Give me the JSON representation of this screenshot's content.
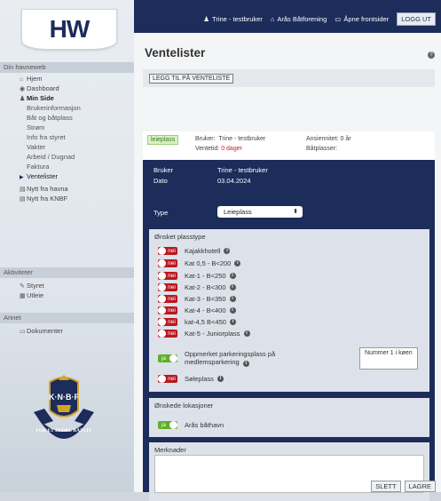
{
  "logo": "HW",
  "sidebar": {
    "section_1": "Din havneweb",
    "items": [
      {
        "label": "Hjem",
        "icon": "home-icon"
      },
      {
        "label": "Dashboard",
        "icon": "dashboard-icon"
      },
      {
        "label": "Min Side",
        "icon": "user-icon"
      }
    ],
    "sub_items": [
      "Brukerinformasjon",
      "Båt og båtplass",
      "Strøm",
      "Info fra styret",
      "Vakter",
      "Arbeid / Dugnad",
      "Faktura",
      "Ventelister"
    ],
    "news": [
      "Nytt fra havna",
      "Nytt fra KNBF"
    ],
    "section_2": "Aktiviteter",
    "activities": [
      "Styret",
      "Utleie"
    ],
    "section_3": "Annet",
    "other": [
      "Dokumenter"
    ],
    "knbf_text": "K·N·B·F",
    "knbf_ring": "FOR ET BEDRE BÅTLIV"
  },
  "topbar": {
    "user": "Trine - testbruker",
    "club": "Arås Båtforening",
    "front": "Åpne frontsider",
    "logout": "LOGG UT"
  },
  "main": {
    "title": "Ventelister",
    "add_button": "LEGG TIL PÅ VENTELISTE"
  },
  "info": {
    "badge": "leieplass",
    "bruker_label": "Bruker:",
    "bruker_value": "Trine - testbruker",
    "ventetid_label": "Ventetid:",
    "ventetid_value": "0 dager",
    "ansiennitet": "Ansiennitet: 0 år",
    "batplasser": "Båtplasser:"
  },
  "form": {
    "bruker_label": "Bruker",
    "bruker_value": "Trine - testbruker",
    "dato_label": "Dato",
    "dato_value": "03.04.2024",
    "type_label": "Type",
    "type_value": "Leieplass",
    "plasstype_header": "Ønsket plasstype",
    "plasstyper": [
      {
        "label": "Kajakkhotell",
        "state": "nei"
      },
      {
        "label": "Kat 0,5 - B<200",
        "state": "nei"
      },
      {
        "label": "Kat-1 - B<250",
        "state": "nei"
      },
      {
        "label": "Kat-2 - B<300",
        "state": "nei"
      },
      {
        "label": "Kat-3 - B<350",
        "state": "nei"
      },
      {
        "label": "Kat-4 - B<400",
        "state": "nei"
      },
      {
        "label": "kat-4,5 B<450",
        "state": "nei"
      },
      {
        "label": "Kat-5 - Juniorplass",
        "state": "nei"
      }
    ],
    "parkering_state": "ja",
    "parkering_label_1": "Oppmerket parkeringsplass på",
    "parkering_label_2": "medlemsparkering",
    "queue_badge": "Nummer 1 i køen",
    "soleplass_state": "nei",
    "soleplass_label": "Søleplass",
    "lokasjon_header": "Ønskede lokasjoner",
    "lokasjon_state": "ja",
    "lokasjon_label": "Arås båthavn",
    "merknader_label": "Merknader"
  },
  "buttons": {
    "delete": "SLETT",
    "save": "LAGRE"
  },
  "colors": {
    "navy": "#1c2c5b",
    "toggle_off": "#b8191e",
    "toggle_on": "#5fae2c"
  }
}
